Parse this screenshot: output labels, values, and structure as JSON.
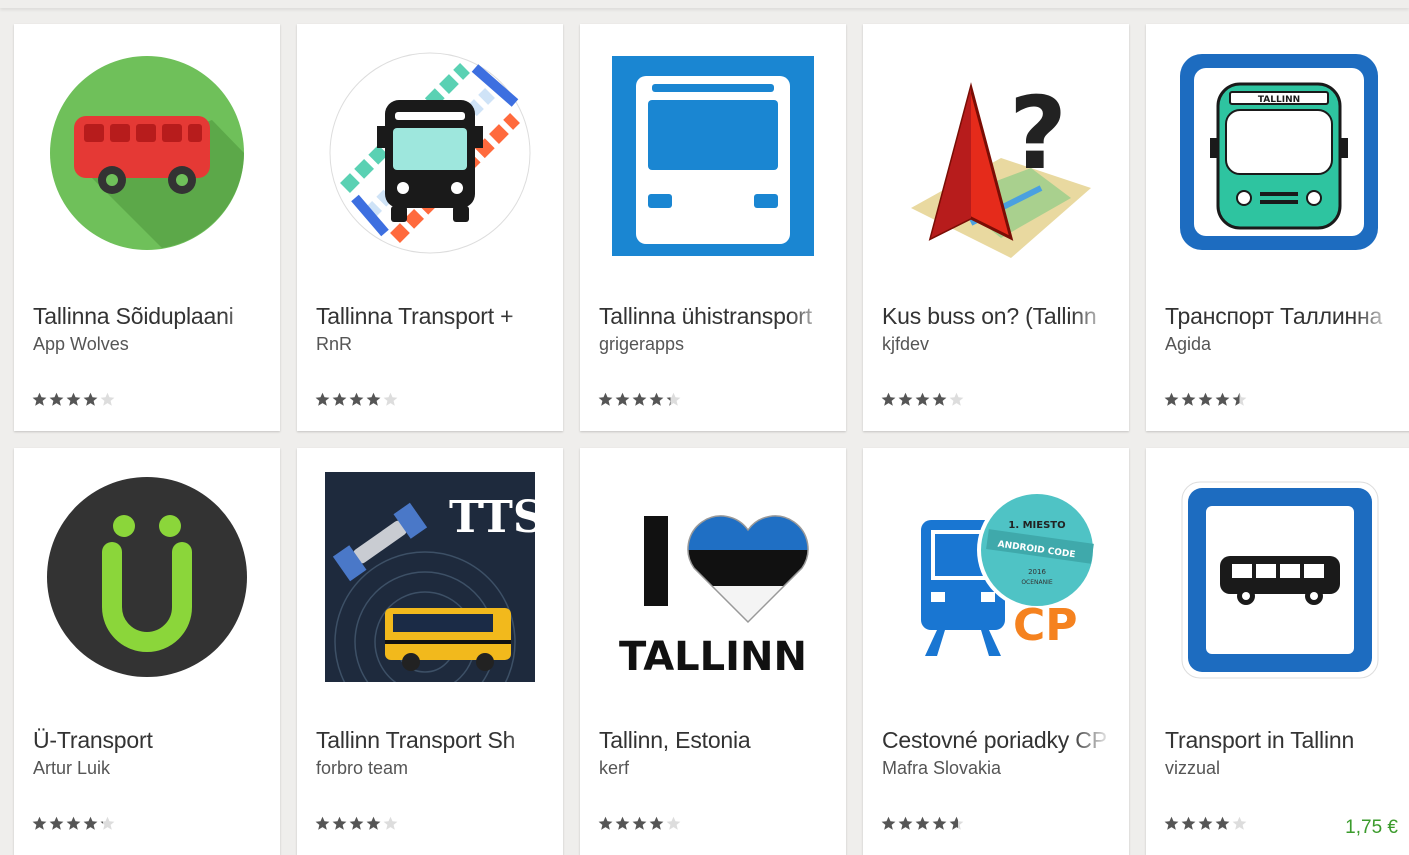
{
  "apps": [
    {
      "title": "Tallinna Sõiduplaani",
      "developer": "App Wolves",
      "rating": 4,
      "icon": "red-bus-icon"
    },
    {
      "title": "Tallinna Transport +",
      "developer": "RnR",
      "rating": 4,
      "icon": "bus-front-icon"
    },
    {
      "title": "Tallinna ühistransport",
      "developer": "grigerapps",
      "rating": 4.3,
      "icon": "blue-bus-front-icon"
    },
    {
      "title": "Kus buss on? (Tallinn",
      "developer": "kjfdev",
      "rating": 4,
      "icon": "map-question-icon"
    },
    {
      "title": "Транспорт Таллинна",
      "developer": "Agida",
      "rating": 4.5,
      "icon": "tallinn-bus-icon"
    },
    {
      "title": "Ü-Transport",
      "developer": "Artur Luik",
      "rating": 4.2,
      "icon": "u-letter-icon"
    },
    {
      "title": "Tallinn Transport Sh",
      "developer": "forbro team",
      "rating": 4,
      "icon": "tts-satellite-bus-icon"
    },
    {
      "title": "Tallinn, Estonia",
      "developer": "kerf",
      "rating": 4,
      "icon": "i-love-tallinn-icon"
    },
    {
      "title": "Cestovné poriadky CP",
      "developer": "Mafra Slovakia",
      "rating": 4.6,
      "icon": "train-cp-icon"
    },
    {
      "title": "Transport in Tallinn",
      "developer": "vizzual",
      "rating": 4,
      "icon": "bus-sign-icon",
      "price": "1,75 €"
    }
  ],
  "icon_texts": {
    "tallinn_bus_sign": "TALLINN",
    "tts": "TTS",
    "i_letter": "I",
    "tallinn_word": "TALLINN",
    "cp": "CP",
    "badge_top": "1. MIESTO",
    "badge_middle": "ANDROID CODE",
    "badge_year": "2016",
    "badge_bottom": "OCENANIE"
  },
  "colors": {
    "star_filled": "#555555",
    "star_empty": "#dddddd",
    "price": "#3b9b2c"
  }
}
